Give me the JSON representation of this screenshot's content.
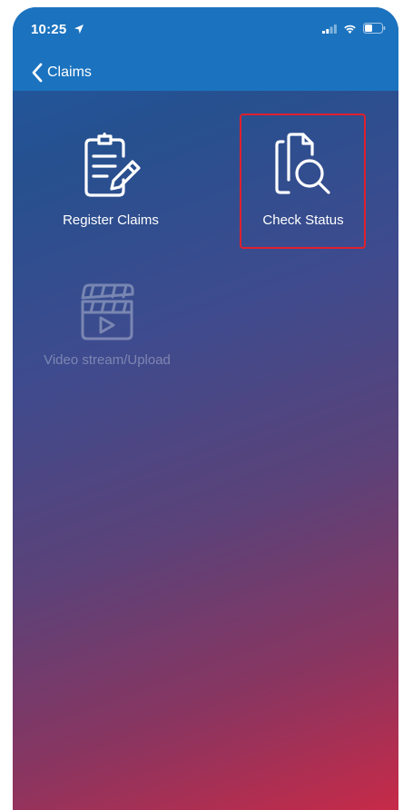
{
  "status_bar": {
    "time": "10:25",
    "icons": [
      "location-arrow-icon",
      "signal-icon",
      "wifi-icon",
      "battery-icon"
    ]
  },
  "nav": {
    "back_label": "Claims"
  },
  "tiles": [
    {
      "label": "Register Claims",
      "icon": "clipboard-edit-icon",
      "enabled": true
    },
    {
      "label": "Check Status",
      "icon": "document-search-icon",
      "enabled": true,
      "highlighted": true
    },
    {
      "label": "Video stream/Upload",
      "icon": "clapperboard-icon",
      "enabled": false
    }
  ],
  "colors": {
    "nav_background": "#1b73bf",
    "gradient_top": "#1e5aa5",
    "gradient_bottom": "#c72a48",
    "highlight_border": "#e0202e",
    "text": "#ffffff"
  }
}
